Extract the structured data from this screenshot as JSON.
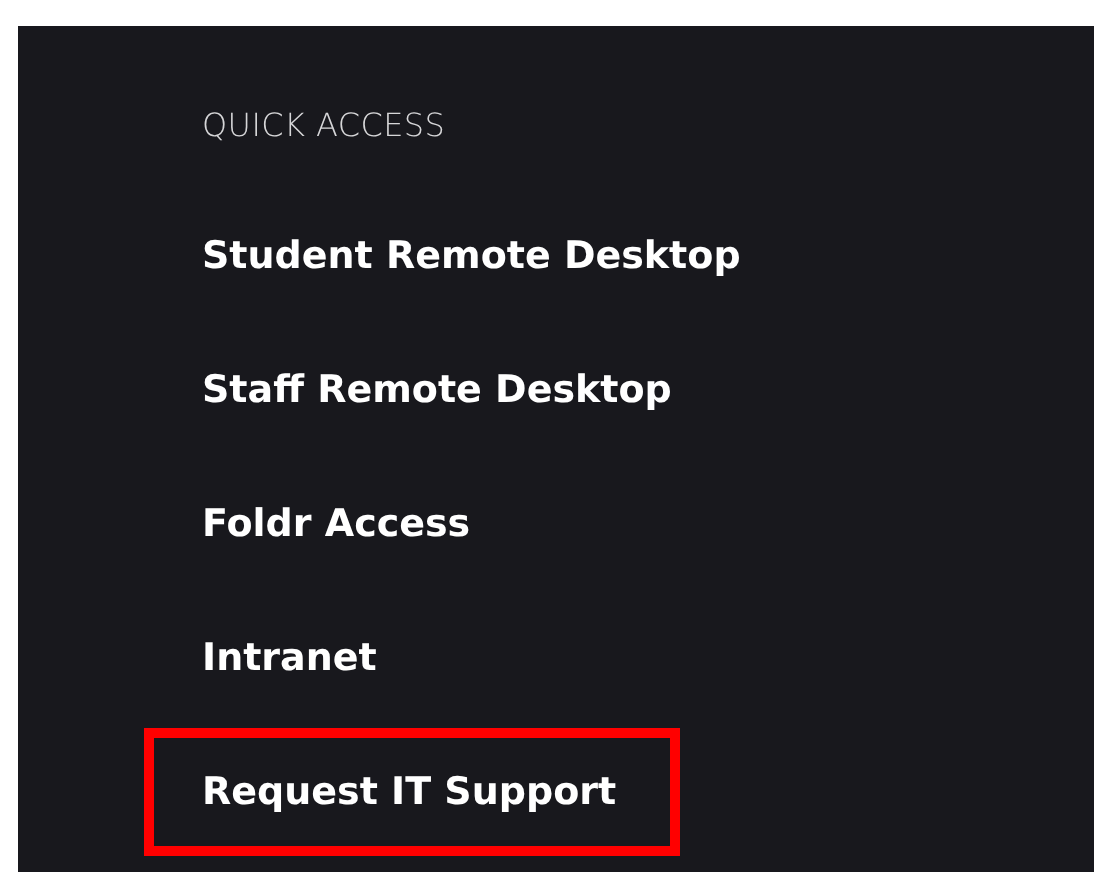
{
  "heading": "QUICK ACCESS",
  "links": [
    {
      "label": "Student Remote Desktop",
      "highlighted": false
    },
    {
      "label": "Staff Remote Desktop",
      "highlighted": false
    },
    {
      "label": "Foldr Access",
      "highlighted": false
    },
    {
      "label": "Intranet",
      "highlighted": false
    },
    {
      "label": "Request IT Support",
      "highlighted": true
    }
  ]
}
